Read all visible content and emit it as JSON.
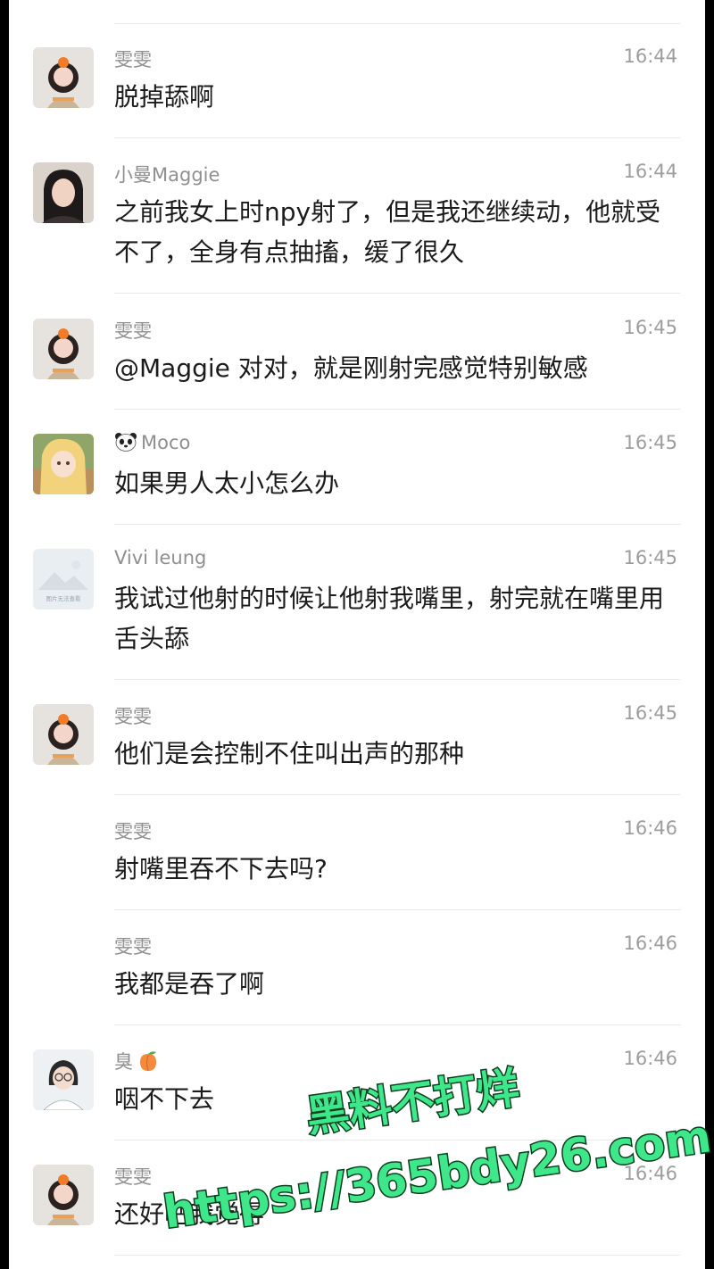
{
  "messages": [
    {
      "name": "雯雯",
      "time": "16:44",
      "text": "脱掉舔啊",
      "avatar": "wenwen"
    },
    {
      "name": "小曼Maggie",
      "time": "16:44",
      "text": "之前我女上时npy射了，但是我还继续动，他就受不了，全身有点抽搐，缓了很久",
      "avatar": "maggie"
    },
    {
      "name": "雯雯",
      "time": "16:45",
      "text": "@Maggie 对对，就是刚射完感觉特别敏感",
      "avatar": "wenwen"
    },
    {
      "name": "Moco",
      "time": "16:45",
      "text": "如果男人太小怎么办",
      "avatar": "moco"
    },
    {
      "name": "Vivi leung",
      "time": "16:45",
      "text": "我试过他射的时候让他射我嘴里，射完就在嘴里用舌头舔",
      "avatar": "vivi",
      "avatar_caption": "图片无法查看"
    },
    {
      "name": "雯雯",
      "time": "16:45",
      "text": "他们是会控制不住叫出声的那种",
      "avatar": "wenwen"
    },
    {
      "name": "雯雯",
      "time": "16:46",
      "text": "射嘴里吞不下去吗?",
      "avatar": "none"
    },
    {
      "name": "雯雯",
      "time": "16:46",
      "text": "我都是吞了啊",
      "avatar": "none"
    },
    {
      "name": "臭",
      "time": "16:46",
      "text": "咽不下去",
      "avatar": "chou"
    },
    {
      "name": "雯雯",
      "time": "16:46",
      "text": "还好吧我觉得",
      "avatar": "wenwen"
    }
  ],
  "icons": {
    "moco_prefix": "panda-emoji-icon",
    "chou_suffix": "peach-emoji-icon"
  },
  "watermark": {
    "line1": "黑料不打烊",
    "line2": "https://365bdy26.com",
    "color": "#3ee88a"
  }
}
